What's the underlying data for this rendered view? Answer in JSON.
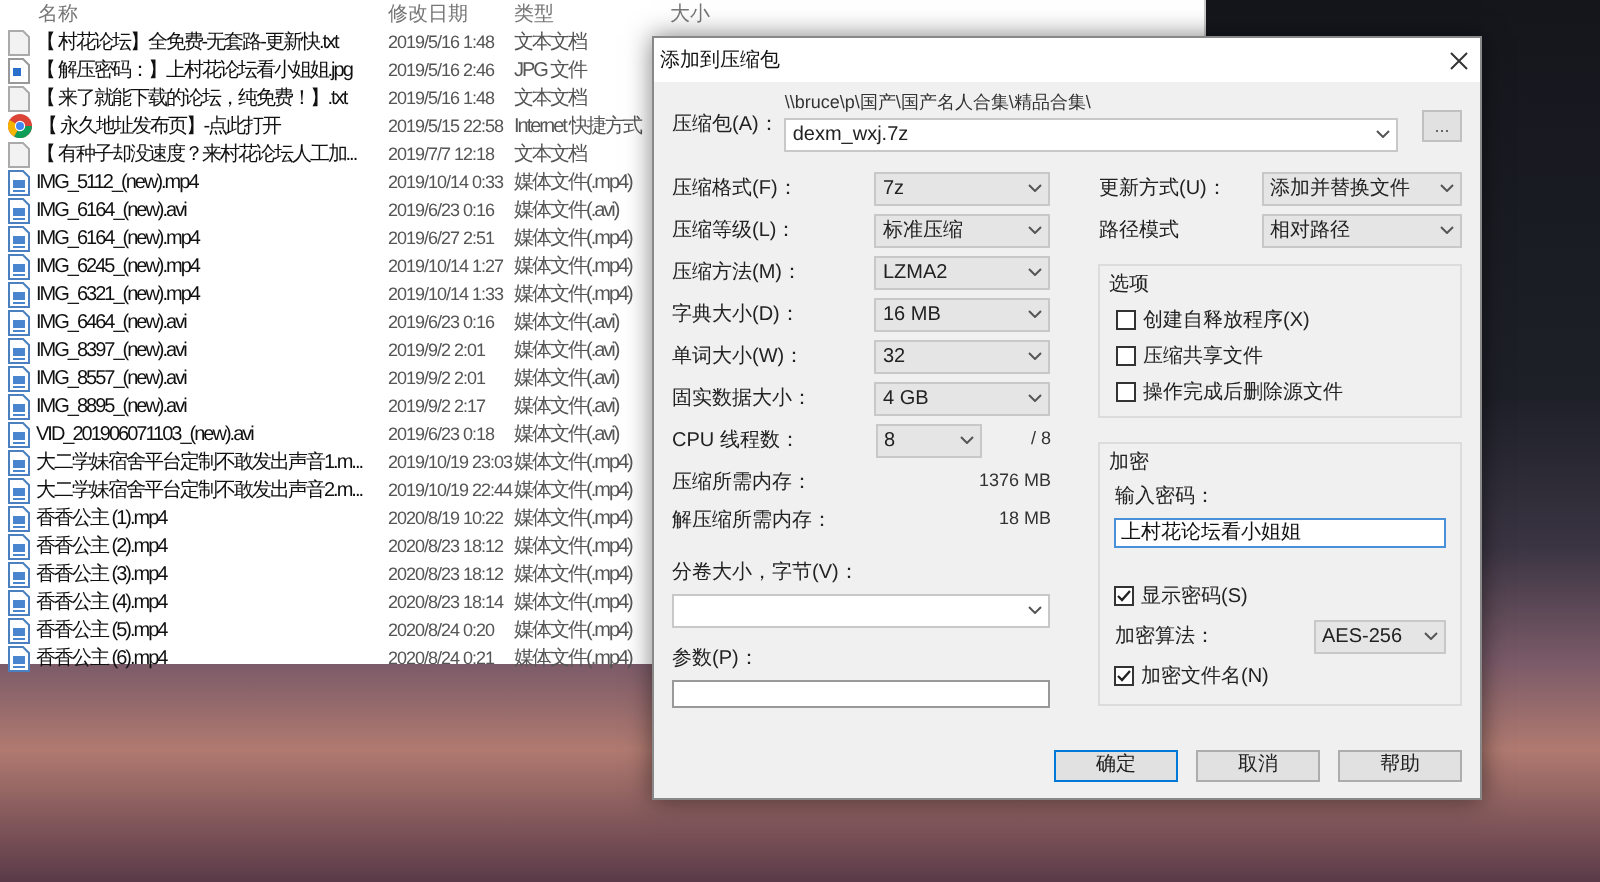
{
  "explorer": {
    "columns": [
      "名称",
      "修改日期",
      "类型",
      "大小"
    ],
    "files": [
      {
        "kind": "text",
        "name": "【 村花论坛】全免费-无套路-更新快.txt",
        "modified": "2019/5/16 1:48",
        "type": "文本文档"
      },
      {
        "kind": "image",
        "name": "【 解压密码：】上村花论坛看小姐姐.jpg",
        "modified": "2019/5/16 2:46",
        "type": "JPG 文件"
      },
      {
        "kind": "text",
        "name": "【 来了就能下载的论坛，纯免费！】.txt",
        "modified": "2019/5/16 1:48",
        "type": "文本文档"
      },
      {
        "kind": "shortcut",
        "name": "【 永久地址发布页】-点此打开",
        "modified": "2019/5/15 22:58",
        "type": "Internet 快捷方式"
      },
      {
        "kind": "text",
        "name": "【 有种子却没速度？来村花论坛人工加...",
        "modified": "2019/7/7 12:18",
        "type": "文本文档"
      },
      {
        "kind": "media",
        "name": "IMG_5112_(new).mp4",
        "modified": "2019/10/14 0:33",
        "type": "媒体文件(.mp4)"
      },
      {
        "kind": "media",
        "name": "IMG_6164_(new).avi",
        "modified": "2019/6/23 0:16",
        "type": "媒体文件(.avi)"
      },
      {
        "kind": "media",
        "name": "IMG_6164_(new).mp4",
        "modified": "2019/6/27 2:51",
        "type": "媒体文件(.mp4)"
      },
      {
        "kind": "media",
        "name": "IMG_6245_(new).mp4",
        "modified": "2019/10/14 1:27",
        "type": "媒体文件(.mp4)"
      },
      {
        "kind": "media",
        "name": "IMG_6321_(new).mp4",
        "modified": "2019/10/14 1:33",
        "type": "媒体文件(.mp4)"
      },
      {
        "kind": "media",
        "name": "IMG_6464_(new).avi",
        "modified": "2019/6/23 0:16",
        "type": "媒体文件(.avi)"
      },
      {
        "kind": "media",
        "name": "IMG_8397_(new).avi",
        "modified": "2019/9/2 2:01",
        "type": "媒体文件(.avi)"
      },
      {
        "kind": "media",
        "name": "IMG_8557_(new).avi",
        "modified": "2019/9/2 2:01",
        "type": "媒体文件(.avi)"
      },
      {
        "kind": "media",
        "name": "IMG_8895_(new).avi",
        "modified": "2019/9/2 2:17",
        "type": "媒体文件(.avi)"
      },
      {
        "kind": "media",
        "name": "VID_201906071103_(new).avi",
        "modified": "2019/6/23 0:18",
        "type": "媒体文件(.avi)"
      },
      {
        "kind": "media",
        "name": "大二学妹宿舍平台定制不敢发出声音1.m...",
        "modified": "2019/10/19 23:03",
        "type": "媒体文件(.mp4)"
      },
      {
        "kind": "media",
        "name": "大二学妹宿舍平台定制不敢发出声音2.m...",
        "modified": "2019/10/19 22:44",
        "type": "媒体文件(.mp4)"
      },
      {
        "kind": "media",
        "name": "香香公主 (1).mp4",
        "modified": "2020/8/19 10:22",
        "type": "媒体文件(.mp4)"
      },
      {
        "kind": "media",
        "name": "香香公主 (2).mp4",
        "modified": "2020/8/23 18:12",
        "type": "媒体文件(.mp4)"
      },
      {
        "kind": "media",
        "name": "香香公主 (3).mp4",
        "modified": "2020/8/23 18:12",
        "type": "媒体文件(.mp4)"
      },
      {
        "kind": "media",
        "name": "香香公主 (4).mp4",
        "modified": "2020/8/23 18:14",
        "type": "媒体文件(.mp4)"
      },
      {
        "kind": "media",
        "name": "香香公主 (5).mp4",
        "modified": "2020/8/24 0:20",
        "type": "媒体文件(.mp4)"
      },
      {
        "kind": "media",
        "name": "香香公主 (6).mp4",
        "modified": "2020/8/24 0:21",
        "type": "媒体文件(.mp4)"
      }
    ]
  },
  "dialog": {
    "title": "添加到压缩包",
    "archive": {
      "label": "压缩包(A)：",
      "path": "\\\\bruce\\p\\国产\\国产名人合集\\精品合集\\",
      "value": "dexm_wxj.7z"
    },
    "browse_button": "...",
    "settings": [
      {
        "kind": "select",
        "label": "压缩格式(F)：",
        "value": "7z"
      },
      {
        "kind": "select",
        "label": "压缩等级(L)：",
        "value": "标准压缩"
      },
      {
        "kind": "select",
        "label": "压缩方法(M)：",
        "value": "LZMA2"
      },
      {
        "kind": "select",
        "label": "字典大小(D)：",
        "value": "16 MB"
      },
      {
        "kind": "select",
        "label": "单词大小(W)：",
        "value": "32"
      },
      {
        "kind": "select",
        "label": "固实数据大小：",
        "value": "4 GB"
      },
      {
        "kind": "threads",
        "label": "CPU 线程数：",
        "value": "8",
        "suffix": "/ 8"
      },
      {
        "kind": "info",
        "label": "压缩所需内存：",
        "value": "1376 MB"
      },
      {
        "kind": "info",
        "label": "解压缩所需内存：",
        "value": "18 MB"
      }
    ],
    "volume": {
      "label": "分卷大小，字节(V)："
    },
    "parameters": {
      "label": "参数(P)："
    },
    "right_settings": [
      {
        "label": "更新方式(U)：",
        "value": "添加并替换文件"
      },
      {
        "label": "路径模式",
        "value": "相对路径"
      }
    ],
    "options": {
      "title": "选项",
      "items": [
        {
          "label": "创建自释放程序(X)",
          "checked": false
        },
        {
          "label": "压缩共享文件",
          "checked": false
        },
        {
          "label": "操作完成后删除源文件",
          "checked": false
        }
      ]
    },
    "encryption": {
      "title": "加密",
      "password_label": "输入密码：",
      "password": "上村花论坛看小姐姐",
      "show_password": {
        "label": "显示密码(S)",
        "checked": true
      },
      "method": {
        "label": "加密算法：",
        "value": "AES-256"
      },
      "encrypt_names": {
        "label": "加密文件名(N)",
        "checked": true
      }
    },
    "buttons": [
      {
        "label": "确定",
        "selected": true
      },
      {
        "label": "取消",
        "selected": false
      },
      {
        "label": "帮助",
        "selected": false
      }
    ]
  }
}
